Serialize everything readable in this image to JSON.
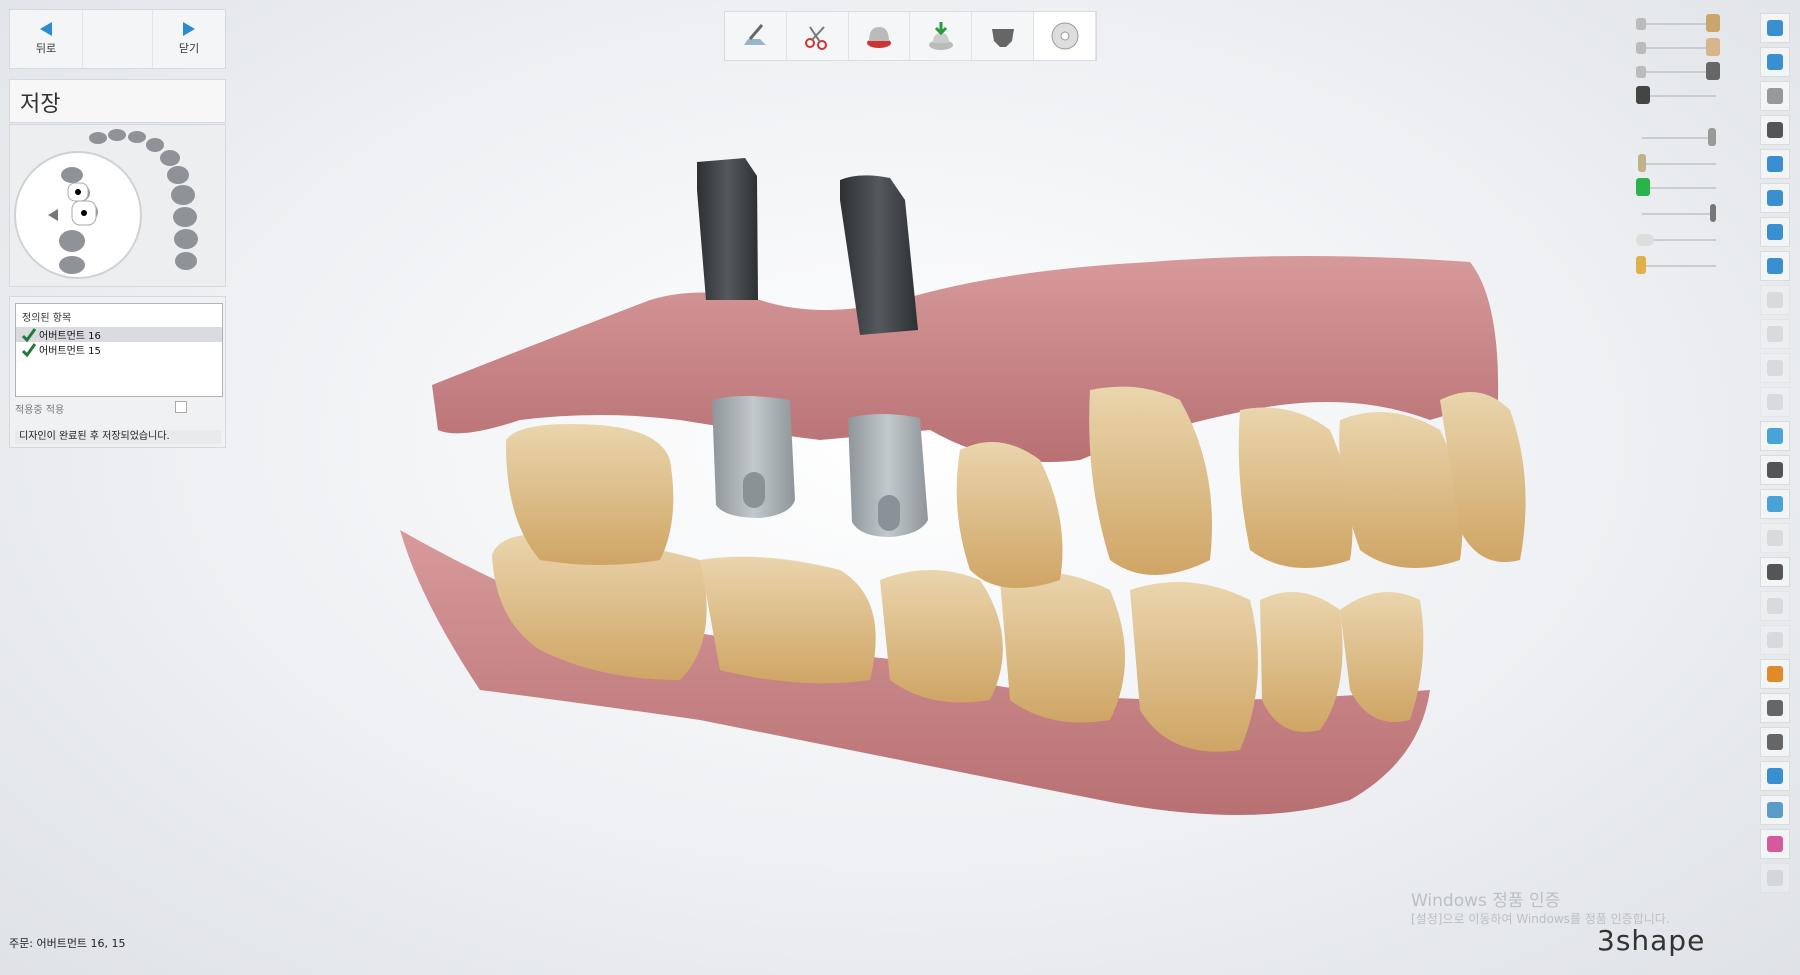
{
  "nav": {
    "back_label": "뒤로",
    "close_label": "닫기"
  },
  "step": {
    "title": "저장"
  },
  "defined": {
    "header": "정의된 항목",
    "items": [
      {
        "label": "어버트먼트 16",
        "checked": true
      },
      {
        "label": "어버트먼트 15",
        "checked": true
      }
    ],
    "option_label": "적용중 적용",
    "message": "디자인이 완료된 후 저장되었습니다."
  },
  "toolbar": {
    "steps": [
      {
        "icon": "prep-icon",
        "active": false
      },
      {
        "icon": "scissors-icon",
        "active": false
      },
      {
        "icon": "abutment-icon",
        "active": false
      },
      {
        "icon": "download-abutment-icon",
        "active": false
      },
      {
        "icon": "crown-icon",
        "active": false
      },
      {
        "icon": "save-disc-icon",
        "active": true
      }
    ]
  },
  "sliders": [
    {
      "icon": "upper-crown-icon",
      "level": 0.85
    },
    {
      "icon": "lower-crown-icon",
      "level": 0.85
    },
    {
      "icon": "gingiva-icon",
      "level": 0.85
    },
    {
      "icon": "implant-icon",
      "level": 0.05
    },
    {
      "icon": "screw-icon",
      "level": 0.85
    },
    {
      "icon": "post-icon",
      "level": 0.05
    },
    {
      "icon": "green-abutment-icon",
      "level": 0.05
    },
    {
      "icon": "pin-icon",
      "level": 0.85
    },
    {
      "icon": "cap-icon",
      "level": 0.05
    },
    {
      "icon": "brush-icon",
      "level": 0.05
    }
  ],
  "right_tools": [
    {
      "icon": "close-window-icon",
      "dim": false
    },
    {
      "icon": "fullscreen-icon",
      "dim": false
    },
    {
      "icon": "view-icon",
      "dim": false
    },
    {
      "icon": "graduate-icon",
      "dim": false
    },
    {
      "icon": "cube-front-icon",
      "dim": false
    },
    {
      "icon": "cube-side-icon",
      "dim": false
    },
    {
      "icon": "cube-top-icon",
      "dim": false
    },
    {
      "icon": "cube-bottom-icon",
      "dim": false
    },
    {
      "icon": "edit-disabled-icon",
      "dim": true
    },
    {
      "icon": "edit2-disabled-icon",
      "dim": true
    },
    {
      "icon": "zoom-disabled-icon",
      "dim": true
    },
    {
      "icon": "rotate-disabled-icon",
      "dim": true
    },
    {
      "icon": "mountain-icon",
      "dim": false
    },
    {
      "icon": "ruler-icon",
      "dim": false
    },
    {
      "icon": "ring-icon",
      "dim": false
    },
    {
      "icon": "tooth-disabled-icon",
      "dim": true
    },
    {
      "icon": "warning-icon",
      "dim": false
    },
    {
      "icon": "box-disabled-icon",
      "dim": true
    },
    {
      "icon": "camera-disabled-icon",
      "dim": true
    },
    {
      "icon": "color-ball-icon",
      "dim": false
    },
    {
      "icon": "shield-icon",
      "dim": false
    },
    {
      "icon": "axis-icon",
      "dim": false
    },
    {
      "icon": "measure-icon",
      "dim": false
    },
    {
      "icon": "stack-icon",
      "dim": false
    },
    {
      "icon": "color-wheel-icon",
      "dim": false
    },
    {
      "icon": "az-disabled-icon",
      "dim": true
    }
  ],
  "order": {
    "label": "주문:",
    "value": "어버트먼트 16, 15"
  },
  "watermark": {
    "title": "Windows 정품 인증",
    "subtitle": "[설정]으로 이동하여 Windows를 정품 인증합니다."
  },
  "brand": {
    "logo_text": "3shape"
  },
  "colors": {
    "accent": "#2c8ccf",
    "check": "#1f7a3d",
    "gum": "#c98a8c",
    "tooth": "#e3c79a",
    "abutment": "#a9b0b4",
    "post": "#3f4245"
  }
}
